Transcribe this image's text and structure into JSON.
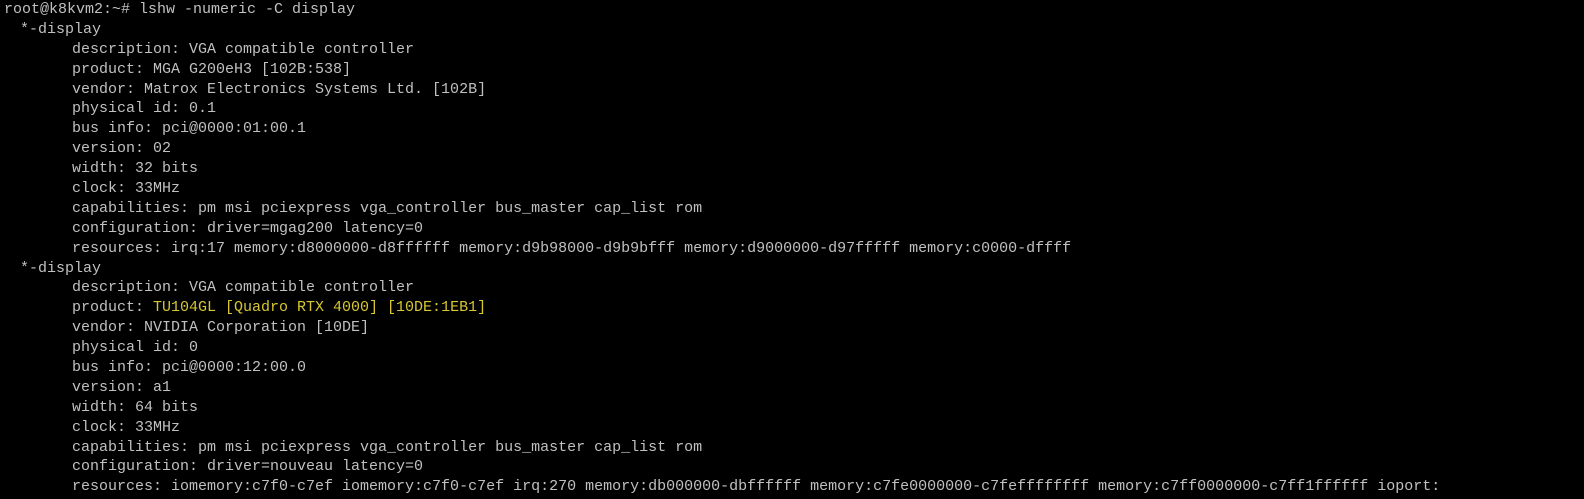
{
  "terminal": {
    "prompt": "root@k8kvm2:~# lshw -numeric -C display",
    "devices": [
      {
        "header": "*-display",
        "description": "description: VGA compatible controller",
        "product_label": "product: ",
        "product_value": "MGA G200eH3 [102B:538]",
        "vendor": "vendor: Matrox Electronics Systems Ltd. [102B]",
        "physical_id": "physical id: 0.1",
        "bus_info": "bus info: pci@0000:01:00.1",
        "version": "version: 02",
        "width": "width: 32 bits",
        "clock": "clock: 33MHz",
        "capabilities": "capabilities: pm msi pciexpress vga_controller bus_master cap_list rom",
        "configuration": "configuration: driver=mgag200 latency=0",
        "resources": "resources: irq:17 memory:d8000000-d8ffffff memory:d9b98000-d9b9bfff memory:d9000000-d97fffff memory:c0000-dffff"
      },
      {
        "header": "*-display",
        "description": "description: VGA compatible controller",
        "product_label": "product: ",
        "product_value": "TU104GL [Quadro RTX 4000] [10DE:1EB1]",
        "vendor": "vendor: NVIDIA Corporation [10DE]",
        "physical_id": "physical id: 0",
        "bus_info": "bus info: pci@0000:12:00.0",
        "version": "version: a1",
        "width": "width: 64 bits",
        "clock": "clock: 33MHz",
        "capabilities": "capabilities: pm msi pciexpress vga_controller bus_master cap_list rom",
        "configuration": "configuration: driver=nouveau latency=0",
        "resources": "resources: iomemory:c7f0-c7ef iomemory:c7f0-c7ef irq:270 memory:db000000-dbffffff memory:c7fe0000000-c7feffffffff memory:c7ff0000000-c7ff1ffffff ioport:"
      }
    ],
    "colors": {
      "background": "#000000",
      "text": "#c0c0c0",
      "highlight": "#d6c733"
    }
  }
}
